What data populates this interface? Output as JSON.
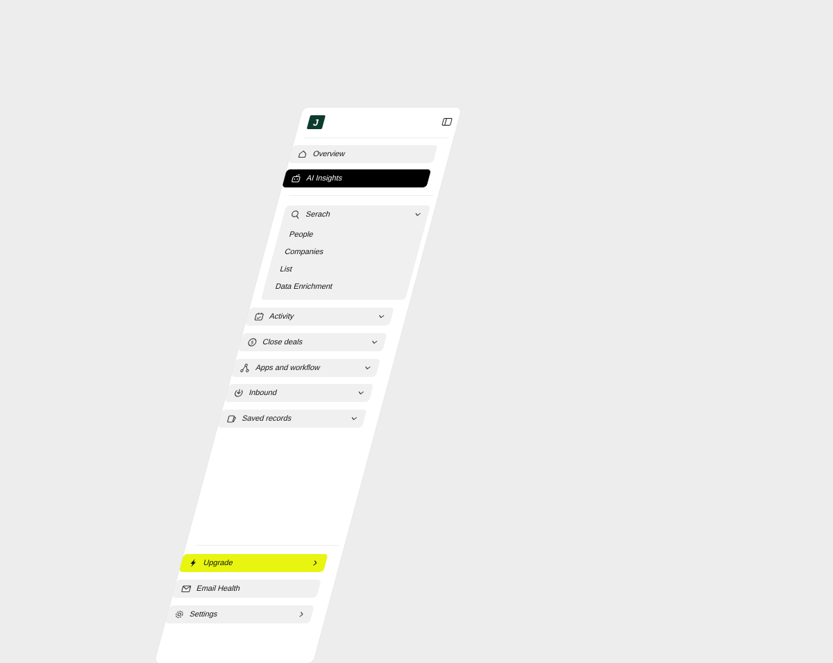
{
  "brand": {
    "logo_letter": "J",
    "logo_color": "#0d3b2e"
  },
  "header": {
    "toggle_icon": "sidebar-toggle-icon"
  },
  "nav": {
    "overview": {
      "label": "Overview",
      "icon": "home-icon"
    },
    "ai_insights": {
      "label": "AI Insights",
      "icon": "robot-icon"
    },
    "search": {
      "label": "Serach",
      "icon": "search-icon",
      "items": [
        "People",
        "Companies",
        "List",
        "Data Enrichment"
      ]
    },
    "activity": {
      "label": "Activity",
      "icon": "calendar-icon"
    },
    "close_deals": {
      "label": "Close deals",
      "icon": "coin-icon"
    },
    "apps": {
      "label": "Apps and workflow",
      "icon": "workflow-icon"
    },
    "inbound": {
      "label": "Inbound",
      "icon": "inbound-icon"
    },
    "saved": {
      "label": "Saved records",
      "icon": "cards-icon"
    }
  },
  "footer": {
    "upgrade": {
      "label": "Upgrade",
      "icon": "bolt-icon",
      "color": "#e8f510"
    },
    "email_health": {
      "label": "Email Health",
      "icon": "mail-icon"
    },
    "settings": {
      "label": "Settings",
      "icon": "gear-icon"
    }
  }
}
